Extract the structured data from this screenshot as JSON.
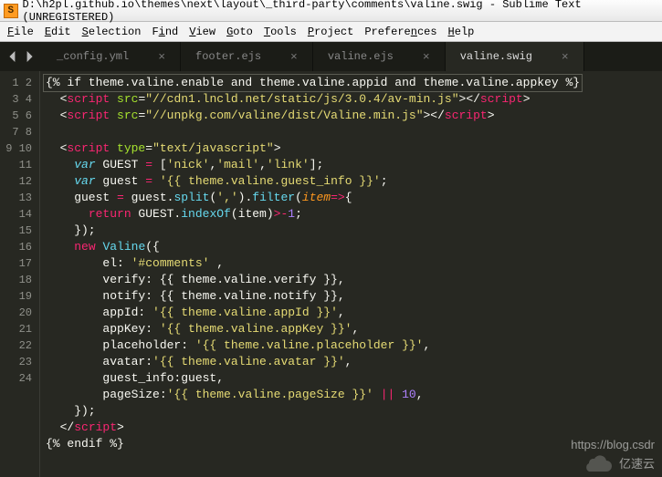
{
  "window": {
    "title": "D:\\h2pl.github.io\\themes\\next\\layout\\_third-party\\comments\\valine.swig - Sublime Text (UNREGISTERED)",
    "appicon_glyph": "S"
  },
  "menu": {
    "file": "File",
    "edit": "Edit",
    "selection": "Selection",
    "find": "Find",
    "view": "View",
    "goto": "Goto",
    "tools": "Tools",
    "project": "Project",
    "preferences": "Preferences",
    "help": "Help"
  },
  "tabs": [
    {
      "label": "_config.yml",
      "active": false
    },
    {
      "label": "footer.ejs",
      "active": false
    },
    {
      "label": "valine.ejs",
      "active": false
    },
    {
      "label": "valine.swig",
      "active": true
    }
  ],
  "gutter": {
    "start": 1,
    "end": 24
  },
  "code": {
    "l1": "{% if theme.valine.enable and theme.valine.appid and theme.valine.appkey %}",
    "l2a": "  <",
    "l2tag": "script",
    "l2b": " ",
    "l2attr": "src",
    "l2c": "=",
    "l2str": "\"//cdn1.lncld.net/static/js/3.0.4/av-min.js\"",
    "l2d": "></",
    "l2e": ">",
    "l3a": "  <",
    "l3tag": "script",
    "l3b": " ",
    "l3attr": "src",
    "l3c": "=",
    "l3str": "\"//unpkg.com/valine/dist/Valine.min.js\"",
    "l3d": "></",
    "l3e": ">",
    "l5a": "  <",
    "l5tag": "script",
    "l5b": " ",
    "l5attr": "type",
    "l5c": "=",
    "l5str": "\"text/javascript\"",
    "l5d": ">",
    "l6a": "    ",
    "l6kw": "var",
    "l6b": " GUEST ",
    "l6op": "=",
    "l6c": " [",
    "l6s1": "'nick'",
    "l6d": ",",
    "l6s2": "'mail'",
    "l6e": ",",
    "l6s3": "'link'",
    "l6f": "];",
    "l7a": "    ",
    "l7kw": "var",
    "l7b": " guest ",
    "l7op": "=",
    "l7c": " ",
    "l7str": "'{{ theme.valine.guest_info }}'",
    "l7d": ";",
    "l8a": "    guest ",
    "l8op": "=",
    "l8b": " guest.",
    "l8fn1": "split",
    "l8c": "(",
    "l8str": "','",
    "l8d": ").",
    "l8fn2": "filter",
    "l8e": "(",
    "l8arg": "item",
    "l8arrow": "=>",
    "l8f": "{",
    "l9a": "      ",
    "l9kw": "return",
    "l9b": " GUEST.",
    "l9fn": "indexOf",
    "l9c": "(item)",
    "l9op": ">-",
    "l9num": "1",
    "l9d": ";",
    "l10": "    });",
    "l11a": "    ",
    "l11kw": "new",
    "l11b": " ",
    "l11fn": "Valine",
    "l11c": "({",
    "l12a": "        el: ",
    "l12str": "'#comments'",
    "l12b": " ,",
    "l13a": "        verify: {{ theme.valine.verify }},",
    "l14a": "        notify: {{ theme.valine.notify }},",
    "l15a": "        appId: ",
    "l15str": "'{{ theme.valine.appId }}'",
    "l15b": ",",
    "l16a": "        appKey: ",
    "l16str": "'{{ theme.valine.appKey }}'",
    "l16b": ",",
    "l17a": "        placeholder: ",
    "l17str": "'{{ theme.valine.placeholder }}'",
    "l17b": ",",
    "l18a": "        avatar:",
    "l18str": "'{{ theme.valine.avatar }}'",
    "l18b": ",",
    "l19a": "        guest_info:guest,",
    "l20a": "        pageSize:",
    "l20str": "'{{ theme.valine.pageSize }}'",
    "l20b": " ",
    "l20op": "||",
    "l20c": " ",
    "l20num": "10",
    "l20d": ",",
    "l21": "    });",
    "l22a": "  </",
    "l22tag": "script",
    "l22b": ">",
    "l23": "{% endif %}"
  },
  "watermark": {
    "text": "https://blog.csdr",
    "brand": "亿速云"
  }
}
